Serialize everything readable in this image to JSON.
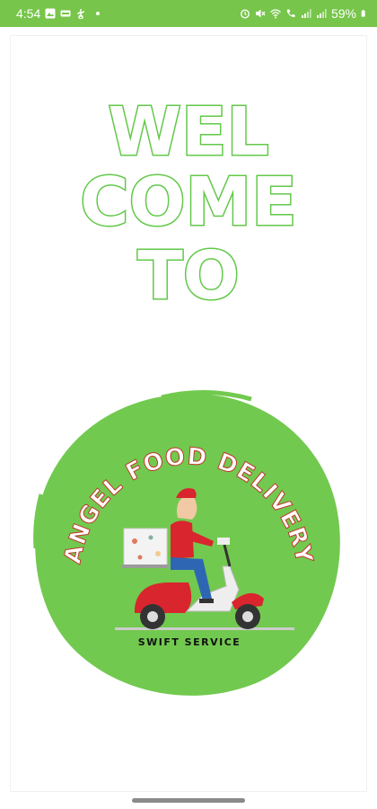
{
  "status_bar": {
    "time": "4:54",
    "battery": "59%",
    "left_icons": [
      "gallery-icon",
      "video-icon",
      "usb-icon",
      "notification-dot-icon"
    ],
    "right_icons": [
      "alarm-icon",
      "mute-icon",
      "wifi-icon",
      "call-icon",
      "signal-icon",
      "signal-icon",
      "battery-icon"
    ],
    "color": "#77c54a"
  },
  "welcome": {
    "line1": "WEL",
    "line2": "COME",
    "line3": "TO",
    "color": "#62c849"
  },
  "logo": {
    "brand_name": "ANGEL FOOD DELIVERY",
    "tagline": "SWIFT SERVICE",
    "circle_color": "#72c94f",
    "scooter_color": "#d9252d"
  }
}
